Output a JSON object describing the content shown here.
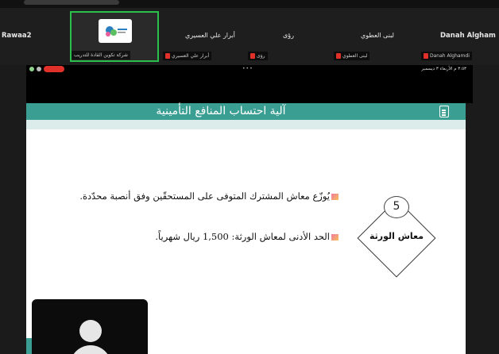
{
  "meeting_strip": {
    "participants": [
      {
        "name": "Rawaa2",
        "sub": ""
      },
      {
        "name": "أبرار علي العسيري",
        "sub": "أبرار علي العسيري"
      },
      {
        "name": "رؤى",
        "sub": "رؤى"
      },
      {
        "name": "لبنى العطوي",
        "sub": "لبنى العطوي"
      },
      {
        "name": "Danah Algham",
        "sub": "Danah Alghamdi"
      }
    ],
    "active_speaker": {
      "sub": "شركة تكوين القادة للتدريب"
    }
  },
  "screen_share": {
    "time": "٣:٥٣ م  الأربعاء ٣ ديسمبر",
    "dots": "•••",
    "slide": {
      "title": "آلية احتساب المنافع التأمينية",
      "bullets": [
        "يُوزّع معاش المشترك المتوفى على المستحقّين وفق أنصبة محدّدة.",
        "الحد الأدنى لمعاش الورثة: 1,500 ريال شهرياً."
      ],
      "badge_number": "5",
      "badge_label": "معاش الورثة"
    }
  },
  "colors": {
    "accent_teal": "#3a9e92",
    "active_border": "#2bbf4d",
    "muted_red": "#e0302a"
  }
}
